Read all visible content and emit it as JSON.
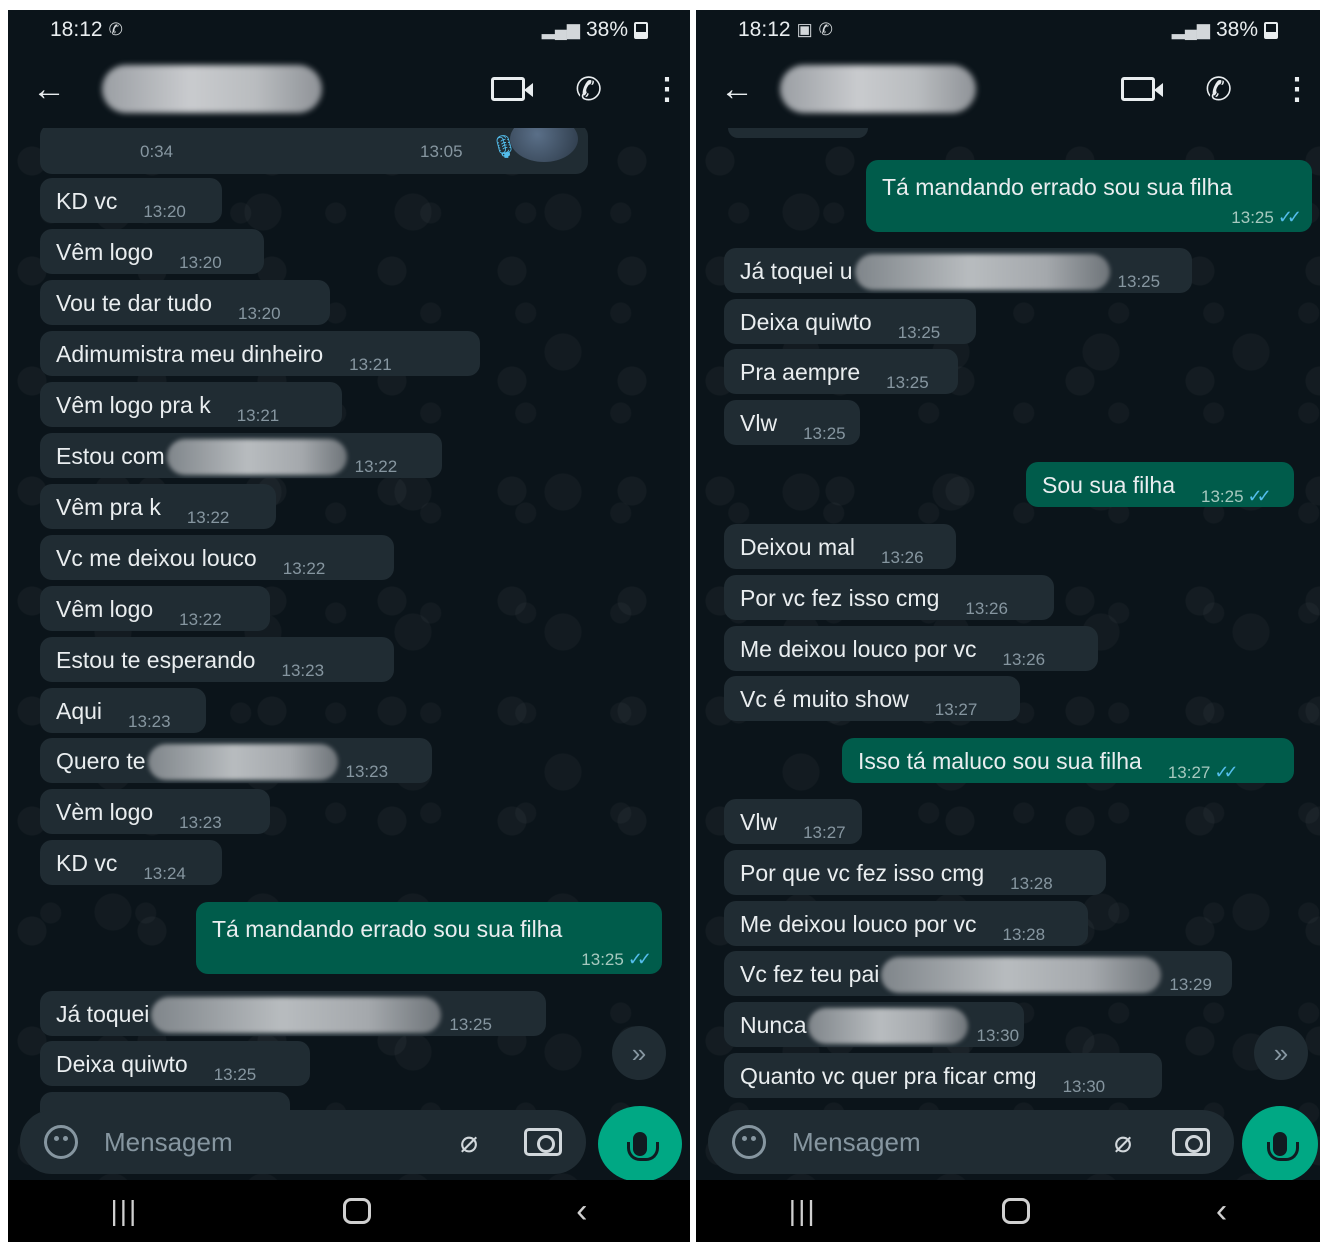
{
  "status_bar": {
    "time": "18:12",
    "battery": "38%"
  },
  "composer": {
    "placeholder": "Mensagem"
  },
  "left": {
    "voice": {
      "duration": "0:34",
      "time": "13:05"
    },
    "messages": [
      {
        "text": "KD vc",
        "time": "13:20",
        "dir": "in"
      },
      {
        "text": "Vêm logo",
        "time": "13:20",
        "dir": "in"
      },
      {
        "text": "Vou te dar tudo",
        "time": "13:20",
        "dir": "in"
      },
      {
        "text": "Adimumistra meu dinheiro",
        "time": "13:21",
        "dir": "in"
      },
      {
        "text": "Vêm logo pra k",
        "time": "13:21",
        "dir": "in"
      },
      {
        "text": "Estou com",
        "time": "13:22",
        "dir": "in",
        "redacted": true
      },
      {
        "text": "Vêm pra k",
        "time": "13:22",
        "dir": "in"
      },
      {
        "text": "Vc me deixou louco",
        "time": "13:22",
        "dir": "in"
      },
      {
        "text": "Vêm logo",
        "time": "13:22",
        "dir": "in"
      },
      {
        "text": "Estou te esperando",
        "time": "13:23",
        "dir": "in"
      },
      {
        "text": "Aqui",
        "time": "13:23",
        "dir": "in"
      },
      {
        "text": "Quero te",
        "time": "13:23",
        "dir": "in",
        "redacted": true
      },
      {
        "text": "Vèm logo",
        "time": "13:23",
        "dir": "in"
      },
      {
        "text": "KD vc",
        "time": "13:24",
        "dir": "in"
      },
      {
        "text": "Tá mandando errado sou sua filha",
        "time": "13:25",
        "dir": "out"
      },
      {
        "text": "Já toquei",
        "time": "13:25",
        "dir": "in",
        "redacted": true
      },
      {
        "text": "Deixa quiwto",
        "time": "13:25",
        "dir": "in"
      }
    ]
  },
  "right": {
    "messages": [
      {
        "text": "Tá mandando errado sou sua filha",
        "time": "13:25",
        "dir": "out"
      },
      {
        "text": "Já toquei u",
        "time": "13:25",
        "dir": "in",
        "redacted": true
      },
      {
        "text": "Deixa quiwto",
        "time": "13:25",
        "dir": "in"
      },
      {
        "text": "Pra aempre",
        "time": "13:25",
        "dir": "in"
      },
      {
        "text": "Vlw",
        "time": "13:25",
        "dir": "in"
      },
      {
        "text": "Sou sua filha",
        "time": "13:25",
        "dir": "out"
      },
      {
        "text": "Deixou mal",
        "time": "13:26",
        "dir": "in"
      },
      {
        "text": "Por vc fez isso cmg",
        "time": "13:26",
        "dir": "in"
      },
      {
        "text": "Me deixou louco por vc",
        "time": "13:26",
        "dir": "in"
      },
      {
        "text": "Vc é muito show",
        "time": "13:27",
        "dir": "in"
      },
      {
        "text": "Isso tá maluco sou sua filha",
        "time": "13:27",
        "dir": "out"
      },
      {
        "text": "Vlw",
        "time": "13:27",
        "dir": "in"
      },
      {
        "text": "Por que vc fez isso cmg",
        "time": "13:28",
        "dir": "in"
      },
      {
        "text": "Me deixou louco por vc",
        "time": "13:28",
        "dir": "in"
      },
      {
        "text": "Vc fez teu pai",
        "time": "13:29",
        "dir": "in",
        "redacted": true
      },
      {
        "text": "Nunca",
        "time": "13:30",
        "dir": "in",
        "redacted": true
      },
      {
        "text": "Quanto vc quer pra ficar cmg",
        "time": "13:30",
        "dir": "in"
      }
    ]
  },
  "colors": {
    "background": "#0b141a",
    "incoming_bubble": "#202c33",
    "outgoing_bubble": "#005c4b",
    "accent": "#00a884",
    "read_ticks": "#53bdeb"
  },
  "icons": {
    "app_bar": [
      "back-arrow-icon",
      "video-call-icon",
      "phone-icon",
      "more-options-icon"
    ],
    "composer": [
      "emoji-sticker-icon",
      "attach-icon",
      "camera-icon",
      "mic-icon"
    ],
    "nav": [
      "recent-apps-icon",
      "home-icon",
      "back-icon"
    ]
  }
}
